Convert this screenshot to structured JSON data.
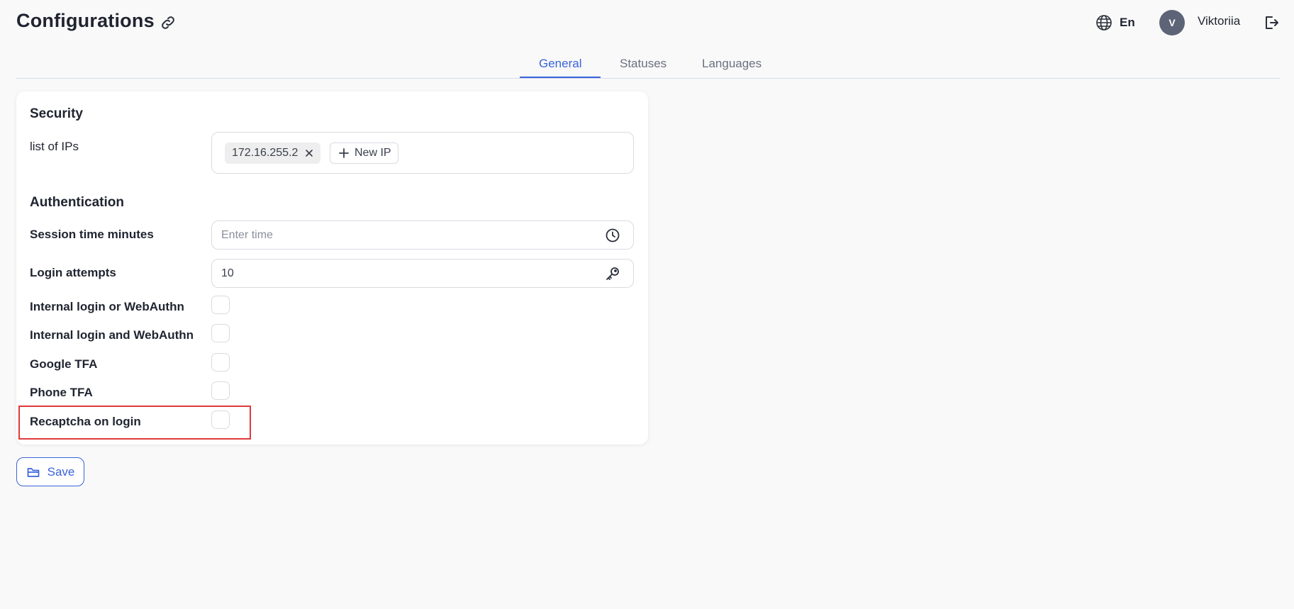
{
  "header": {
    "title": "Configurations",
    "language_label": "En",
    "avatar_initial": "V",
    "user_name": "Viktoriia"
  },
  "tabs": [
    {
      "label": "General",
      "active": true
    },
    {
      "label": "Statuses",
      "active": false
    },
    {
      "label": "Languages",
      "active": false
    }
  ],
  "security": {
    "title": "Security",
    "ip_list_label": "list of IPs",
    "ips": [
      "172.16.255.2"
    ],
    "new_ip_label": "New IP"
  },
  "authentication": {
    "title": "Authentication",
    "session_time": {
      "label": "Session time minutes",
      "placeholder": "Enter time",
      "value": ""
    },
    "login_attempts": {
      "label": "Login attempts",
      "value": "10"
    },
    "checkboxes": [
      {
        "label": "Internal login or WebAuthn",
        "checked": false
      },
      {
        "label": "Internal login and WebAuthn",
        "checked": false
      },
      {
        "label": "Google TFA",
        "checked": false
      },
      {
        "label": "Phone TFA",
        "checked": false
      },
      {
        "label": "Recaptcha on login",
        "checked": false
      }
    ]
  },
  "actions": {
    "save_label": "Save"
  },
  "colors": {
    "accent": "#3a63d8",
    "highlight": "#e03a3a",
    "avatar": "#5d6477"
  },
  "icons": [
    "link-icon",
    "globe-icon",
    "logout-icon",
    "close-icon",
    "plus-icon",
    "clock-icon",
    "key-icon",
    "folder-icon"
  ]
}
